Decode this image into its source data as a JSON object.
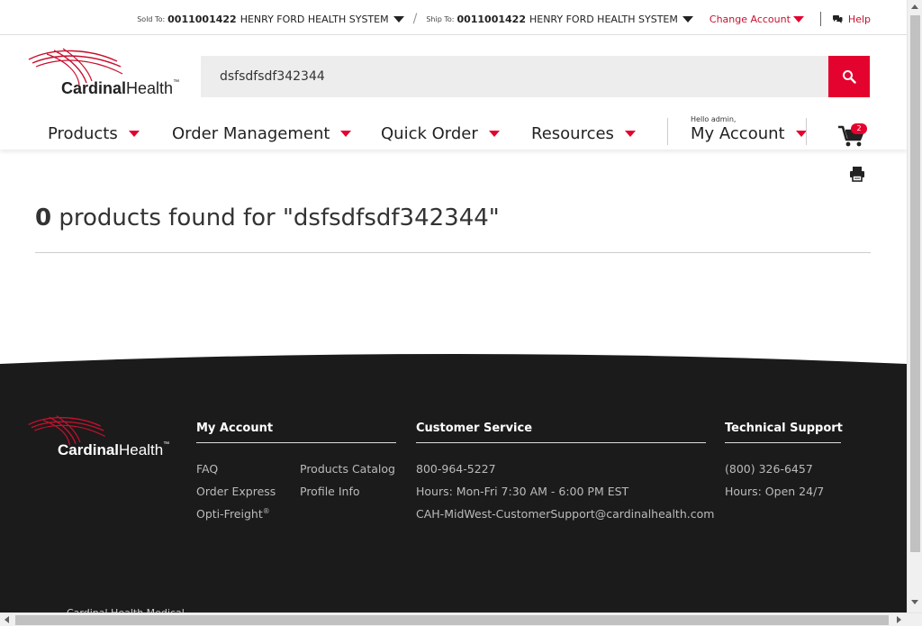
{
  "utility_bar": {
    "sold_to_label": "Sold To:",
    "sold_to_number": "0011001422",
    "sold_to_name": "HENRY FORD HEALTH SYSTEM",
    "ship_to_label": "Ship To:",
    "ship_to_number": "0011001422",
    "ship_to_name": "HENRY FORD HEALTH SYSTEM",
    "separator": "/",
    "change_account": "Change Account",
    "help": "Help"
  },
  "brand": {
    "name_bold": "Cardinal",
    "name_rest": "Health",
    "tm": "™",
    "accent_color": "#e4032e"
  },
  "search": {
    "value": "dsfsdfsdf342344"
  },
  "nav": {
    "items": [
      {
        "label": "Products"
      },
      {
        "label": "Order Management"
      },
      {
        "label": "Quick Order"
      },
      {
        "label": "Resources"
      }
    ],
    "greeting": "Hello admin,",
    "account_label": "My Account",
    "cart_count": "2"
  },
  "results": {
    "count": "0",
    "text": " products found for \"dsfsdfsdf342344\""
  },
  "footer": {
    "my_account": {
      "title": "My Account",
      "col1": [
        "FAQ",
        "Order Express",
        "Opti-Freight"
      ],
      "registered": "®",
      "col2": [
        "Products Catalog",
        "Profile Info"
      ]
    },
    "customer_service": {
      "title": "Customer Service",
      "lines": [
        "800-964-5227",
        "Hours: Mon-Fri 7:30 AM - 6:00 PM EST",
        "CAH-MidWest-CustomerSupport@cardinalhealth.com"
      ]
    },
    "technical_support": {
      "title": "Technical Support",
      "lines": [
        "(800) 326-6457",
        "Hours: Open 24/7"
      ]
    },
    "clipped_text": "Cardinal Health Medical"
  }
}
